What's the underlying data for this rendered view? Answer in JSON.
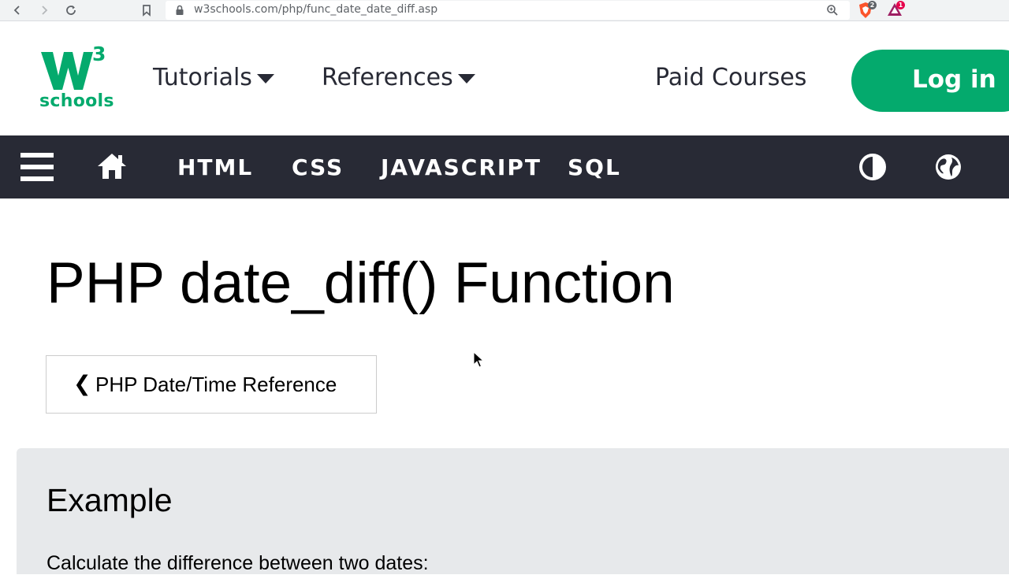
{
  "browser": {
    "url": "w3schools.com/php/func_date_date_diff.asp",
    "extensions": [
      {
        "name": "brave-shield-icon",
        "badge": "2",
        "color": "#fb542b"
      },
      {
        "name": "brave-rewards-icon",
        "badge": "1",
        "color": "#e6004c"
      }
    ]
  },
  "header": {
    "logo": {
      "superscript": "3",
      "word": "schools"
    },
    "menu": [
      {
        "label": "Tutorials"
      },
      {
        "label": "References"
      }
    ],
    "paid_courses": "Paid Courses",
    "login": "Log in"
  },
  "topnav": {
    "items": [
      "HTML",
      "CSS",
      "JAVASCRIPT",
      "SQL"
    ]
  },
  "content": {
    "title": "PHP date_diff() Function",
    "back_chevron": "❮",
    "back_label": "PHP Date/Time Reference",
    "example": {
      "heading": "Example",
      "text": "Calculate the difference between two dates:"
    }
  },
  "colors": {
    "brand": "#04aa6d",
    "nav_bg": "#282a35",
    "example_bg": "#e7e9eb"
  }
}
